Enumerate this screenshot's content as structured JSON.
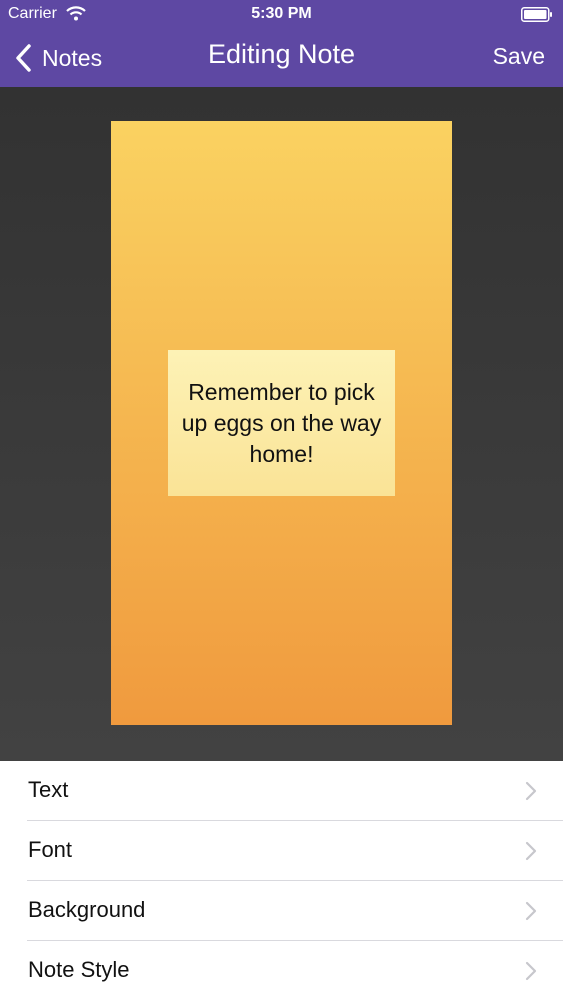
{
  "status_bar": {
    "carrier": "Carrier",
    "time": "5:30 PM",
    "wifi_icon": "wifi-icon",
    "battery_icon": "battery-icon"
  },
  "nav": {
    "back_label": "Notes",
    "title": "Editing Note",
    "save_label": "Save"
  },
  "note": {
    "text": "Remember to pick up eggs on the way home!"
  },
  "options": [
    {
      "label": "Text"
    },
    {
      "label": "Font"
    },
    {
      "label": "Background"
    },
    {
      "label": "Note Style"
    }
  ],
  "colors": {
    "nav_bar": "#5e48a3",
    "canvas_background": "#3a3a3a",
    "note_gradient_top": "#fad261",
    "note_gradient_bottom": "#f09a3e",
    "text_box": "#fcecaa"
  }
}
